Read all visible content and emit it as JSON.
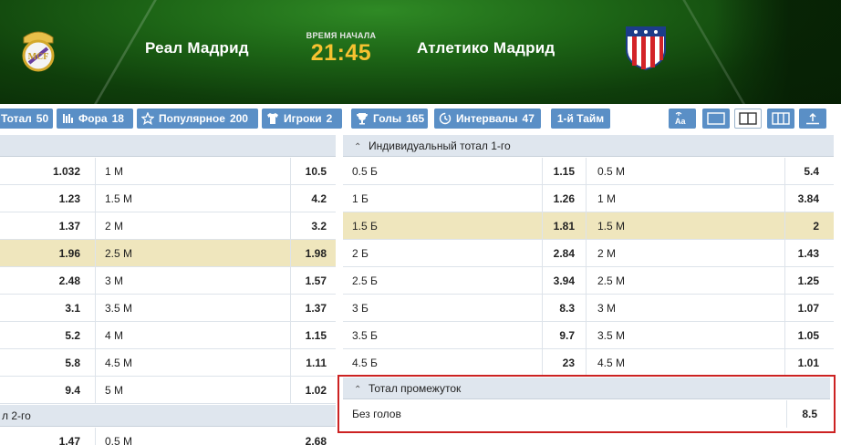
{
  "match": {
    "home_team": "Реал Мадрид",
    "away_team": "Атлетико Мадрид",
    "start_label": "ВРЕМЯ НАЧАЛА",
    "start_time": "21:45"
  },
  "tabs": [
    {
      "label": "Тотал",
      "count": "50",
      "icon": "total-icon"
    },
    {
      "label": "Фора",
      "count": "18",
      "icon": "handicap-icon"
    },
    {
      "label": "Популярное",
      "count": "200",
      "icon": "star-icon"
    },
    {
      "label": "Игроки",
      "count": "2",
      "icon": "shirt-icon"
    },
    {
      "label": "Голы",
      "count": "165",
      "icon": "trophy-icon"
    },
    {
      "label": "Интервалы",
      "count": "47",
      "icon": "clock-icon"
    },
    {
      "label": "1-й Тайм",
      "count": "",
      "icon": ""
    }
  ],
  "view_buttons": [
    "font-size-icon",
    "single-column-icon",
    "two-column-icon",
    "three-column-icon",
    "scroll-top-icon"
  ],
  "left_table": {
    "rows": [
      {
        "over": "1.032",
        "line": "1 М",
        "under": "10.5",
        "highlight": false
      },
      {
        "over": "1.23",
        "line": "1.5 М",
        "under": "4.2",
        "highlight": false
      },
      {
        "over": "1.37",
        "line": "2 М",
        "under": "3.2",
        "highlight": false
      },
      {
        "over": "1.96",
        "line": "2.5 М",
        "under": "1.98",
        "highlight": true
      },
      {
        "over": "2.48",
        "line": "3 М",
        "under": "1.57",
        "highlight": false
      },
      {
        "over": "3.1",
        "line": "3.5 М",
        "under": "1.37",
        "highlight": false
      },
      {
        "over": "5.2",
        "line": "4 М",
        "under": "1.15",
        "highlight": false
      },
      {
        "over": "5.8",
        "line": "4.5 М",
        "under": "1.11",
        "highlight": false
      },
      {
        "over": "9.4",
        "line": "5 М",
        "under": "1.02",
        "highlight": false
      }
    ],
    "next_section_title": "л 2-го",
    "next_row": {
      "over": "1.47",
      "line": "0.5 М",
      "under": "2.68"
    }
  },
  "right_table": {
    "title": "Индивидуальный тотал 1-го",
    "rows": [
      {
        "over_label": "0.5 Б",
        "over": "1.15",
        "under_label": "0.5 М",
        "under": "5.4",
        "highlight": false
      },
      {
        "over_label": "1 Б",
        "over": "1.26",
        "under_label": "1 М",
        "under": "3.84",
        "highlight": false
      },
      {
        "over_label": "1.5 Б",
        "over": "1.81",
        "under_label": "1.5 М",
        "under": "2",
        "highlight": true
      },
      {
        "over_label": "2 Б",
        "over": "2.84",
        "under_label": "2 М",
        "under": "1.43",
        "highlight": false
      },
      {
        "over_label": "2.5 Б",
        "over": "3.94",
        "under_label": "2.5 М",
        "under": "1.25",
        "highlight": false
      },
      {
        "over_label": "3 Б",
        "over": "8.3",
        "under_label": "3 М",
        "under": "1.07",
        "highlight": false
      },
      {
        "over_label": "3.5 Б",
        "over": "9.7",
        "under_label": "3.5 М",
        "under": "1.05",
        "highlight": false
      },
      {
        "over_label": "4.5 Б",
        "over": "23",
        "under_label": "4.5 М",
        "under": "1.01",
        "highlight": false
      }
    ]
  },
  "interval_section": {
    "title": "Тотал промежуток",
    "row": {
      "label": "Без голов",
      "value": "8.5"
    }
  },
  "colors": {
    "tab_bg": "#5a8fc6",
    "highlight_row": "#efe6bd",
    "time": "#f6c230",
    "focus_frame": "#cc2222"
  }
}
